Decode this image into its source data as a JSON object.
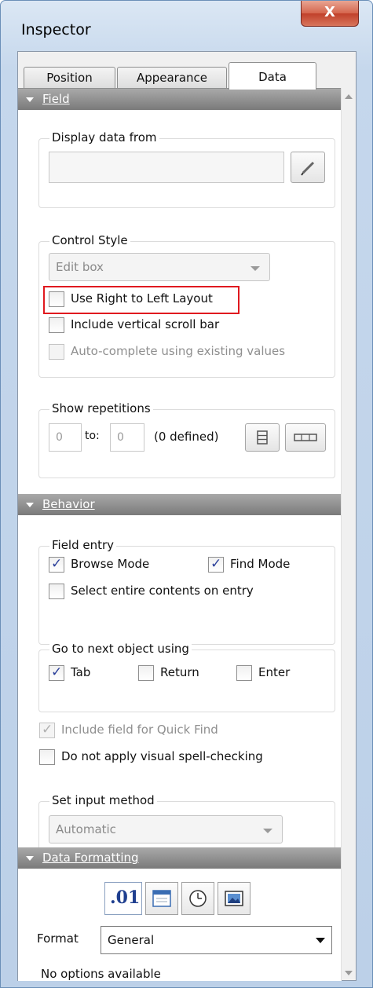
{
  "window": {
    "title": "Inspector",
    "close_label": "X"
  },
  "tabs": [
    {
      "label": "Position"
    },
    {
      "label": "Appearance"
    },
    {
      "label": "Data",
      "active": true
    }
  ],
  "field": {
    "header": "Field",
    "display_from": {
      "legend": "Display data from",
      "value": ""
    },
    "control_style": {
      "legend": "Control Style",
      "selected": "Edit box",
      "use_rtl": {
        "label": "Use Right to Left Layout",
        "checked": false
      },
      "scroll": {
        "label": "Include vertical scroll bar",
        "checked": false
      },
      "autocomplete": {
        "label": "Auto-complete using existing values",
        "checked": false,
        "disabled": true
      }
    },
    "repetitions": {
      "legend": "Show repetitions",
      "from": "0",
      "to_label": "to:",
      "to": "0",
      "defined_text": "(0 defined)"
    }
  },
  "behavior": {
    "header": "Behavior",
    "field_entry": {
      "legend": "Field entry",
      "browse": {
        "label": "Browse Mode",
        "checked": true
      },
      "find": {
        "label": "Find Mode",
        "checked": true
      },
      "select_all": {
        "label": "Select entire contents on entry",
        "checked": false
      }
    },
    "next_object": {
      "legend": "Go to next object using",
      "tab": {
        "label": "Tab",
        "checked": true
      },
      "return": {
        "label": "Return",
        "checked": false
      },
      "enter": {
        "label": "Enter",
        "checked": false
      }
    },
    "quick_find": {
      "label": "Include field for Quick Find",
      "checked": true,
      "disabled": true
    },
    "spell": {
      "label": "Do not apply visual spell-checking",
      "checked": false
    },
    "input_method": {
      "legend": "Set input method",
      "selected": "Automatic"
    }
  },
  "data_formatting": {
    "header": "Data Formatting",
    "number_label": ".01",
    "format_label": "Format",
    "format_value": "General",
    "note": "No options available"
  },
  "colors": {
    "highlight": "#e0191f",
    "section_header": "#8c8c8c",
    "check": "#2a3f9a"
  }
}
